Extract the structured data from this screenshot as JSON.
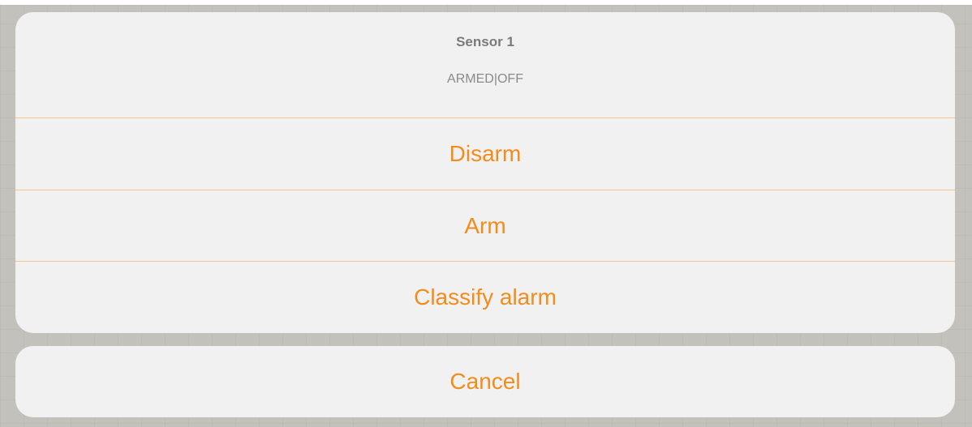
{
  "colors": {
    "accent": "#f28c1c",
    "separator": "#f4c68e"
  },
  "sheet": {
    "title": "Sensor 1",
    "subtitle": "ARMED|OFF",
    "actions": [
      {
        "label": "Disarm"
      },
      {
        "label": "Arm"
      },
      {
        "label": "Classify alarm"
      }
    ],
    "cancel_label": "Cancel"
  }
}
